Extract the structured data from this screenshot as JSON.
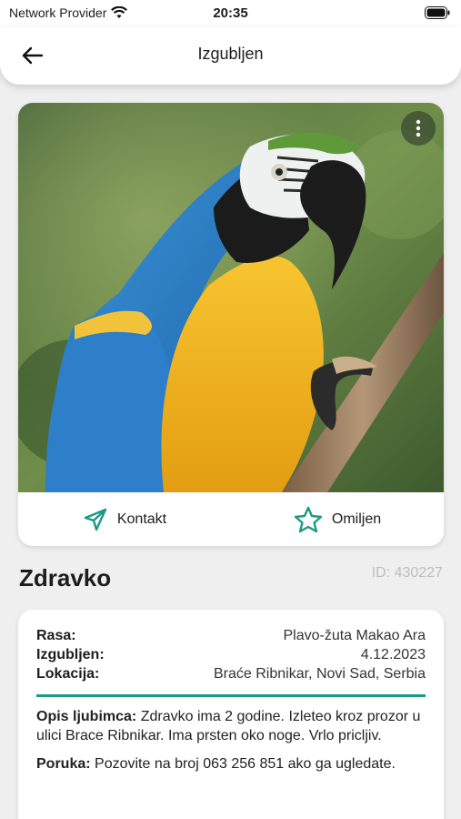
{
  "status_bar": {
    "carrier": "Network Provider",
    "time": "20:35"
  },
  "app_bar": {
    "title": "Izgubljen"
  },
  "actions": {
    "contact": "Kontakt",
    "favorite": "Omiljen"
  },
  "pet": {
    "name": "Zdravko",
    "id": "ID: 430227"
  },
  "details": [
    {
      "label": "Rasa:",
      "value": "Plavo-žuta Makao Ara"
    },
    {
      "label": "Izgubljen:",
      "value": "4.12.2023"
    },
    {
      "label": "Lokacija:",
      "value": "Braće Ribnikar, Novi Sad, Serbia"
    }
  ],
  "description": {
    "label": "Opis ljubimca:",
    "text": " Zdravko ima 2 godine. Izleteo kroz prozor u ulici Brace Ribnikar. Ima prsten oko noge. Vrlo pricljiv."
  },
  "message": {
    "label": "Poruka:",
    "text": " Pozovite na broj 063 256 851 ako ga ugledate."
  },
  "colors": {
    "accent": "#1a9a86",
    "background": "#efefef"
  }
}
